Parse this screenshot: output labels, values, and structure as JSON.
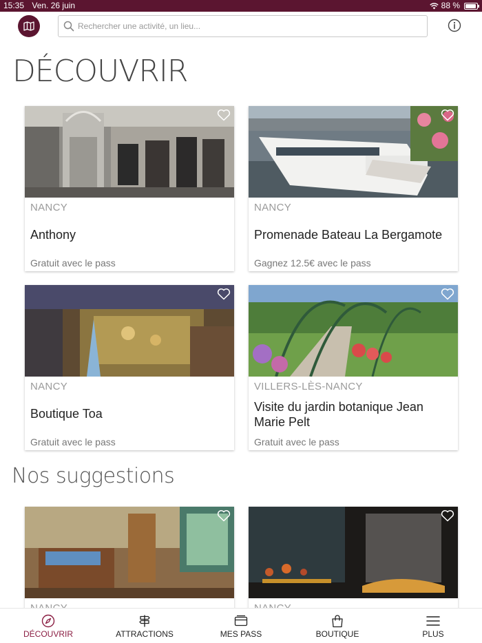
{
  "status": {
    "time": "15:35",
    "date": "Ven. 26 juin",
    "battery": "88 %"
  },
  "search": {
    "placeholder": "Rechercher une activité, un lieu..."
  },
  "icons": {
    "map": "map-icon",
    "info": "info-icon",
    "search": "search-icon",
    "favorite": "heart-outline-icon"
  },
  "colors": {
    "brand": "#5b1530",
    "accent": "#8a1d42"
  },
  "discover": {
    "title": "DÉCOUVRIR",
    "cards": [
      {
        "city": "NANCY",
        "title": "Anthony",
        "price": "Gratuit avec le pass"
      },
      {
        "city": "NANCY",
        "title": "Promenade Bateau La Bergamote",
        "price": "Gagnez 12.5€ avec le pass"
      },
      {
        "city": "NANCY",
        "title": "Boutique Toa",
        "price": "Gratuit avec le pass"
      },
      {
        "city": "VILLERS-LÈS-NANCY",
        "title": "Visite du jardin botanique Jean Marie Pelt",
        "price": "Gratuit avec le pass"
      }
    ]
  },
  "suggestions": {
    "title": "Nos suggestions",
    "cards": [
      {
        "city": "NANCY"
      },
      {
        "city": "NANCY"
      }
    ]
  },
  "nav": {
    "items": [
      {
        "label": "DÉCOUVRIR",
        "icon": "compass-icon",
        "active": true
      },
      {
        "label": "ATTRACTIONS",
        "icon": "signpost-icon",
        "active": false
      },
      {
        "label": "MES PASS",
        "icon": "card-icon",
        "active": false
      },
      {
        "label": "BOUTIQUE",
        "icon": "shopping-bag-icon",
        "active": false
      },
      {
        "label": "PLUS",
        "icon": "menu-icon",
        "active": false
      }
    ]
  }
}
